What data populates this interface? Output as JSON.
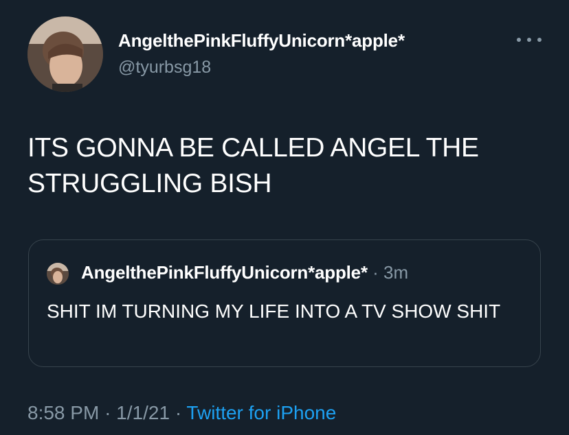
{
  "tweet": {
    "display_name": "AngelthePinkFluffyUnicorn*apple*",
    "handle": "@tyurbsg18",
    "more_icon": "more-horizontal-icon",
    "text": "ITS GONNA BE CALLED ANGEL THE STRUGGLING BISH",
    "quoted": {
      "display_name": "AngelthePinkFluffyUnicorn*apple*",
      "separator": "·",
      "time": "3m",
      "text": "SHIT IM TURNING MY LIFE INTO A TV SHOW SHIT"
    },
    "time": "8:58 PM",
    "date": "1/1/21",
    "separator": "·",
    "source": "Twitter for iPhone"
  },
  "colors": {
    "background": "#15202b",
    "secondary_text": "#8899a6",
    "link": "#1da1f2",
    "border": "#38444d"
  }
}
